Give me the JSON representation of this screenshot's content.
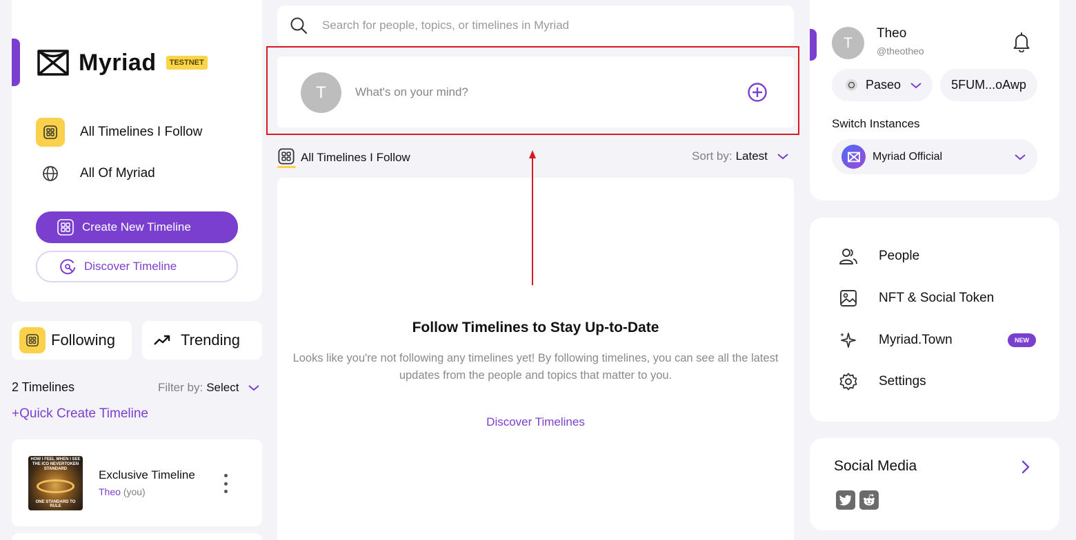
{
  "brand": {
    "name": "Myriad",
    "badge": "TESTNET"
  },
  "left_nav": {
    "items": [
      {
        "label": "All Timelines I Follow",
        "icon": "timeline-folder-icon"
      },
      {
        "label": "All Of Myriad",
        "icon": "globe-icon"
      }
    ],
    "create_button": "Create New Timeline",
    "discover_button": "Discover Timeline"
  },
  "tabs": {
    "following": "Following",
    "trending": "Trending"
  },
  "timelines_panel": {
    "count_label": "2 Timelines",
    "filter_label": "Filter by:",
    "filter_value": "Select",
    "quick_create": "+Quick Create Timeline",
    "items": [
      {
        "title": "Exclusive Timeline",
        "owner": "Theo",
        "owner_suffix": "(you)",
        "thumb_top": "HOW I FEEL WHEN I SEE THE ICO NEVERTOKEN STANDARD",
        "thumb_bottom": "ONE STANDARD TO RULE"
      }
    ]
  },
  "search": {
    "placeholder": "Search for people, topics, or timelines in Myriad"
  },
  "composer": {
    "avatar_initial": "T",
    "placeholder": "What's on your mind?"
  },
  "feed_header": {
    "title": "All Timelines I Follow",
    "sort_label": "Sort by:",
    "sort_value": "Latest"
  },
  "empty_state": {
    "title": "Follow Timelines to Stay Up-to-Date",
    "body": "Looks like you're not following any timelines yet! By following timelines, you can see all the latest updates from the people and topics that matter to you.",
    "link": "Discover Timelines"
  },
  "profile": {
    "initial": "T",
    "name": "Theo",
    "handle": "@theotheo",
    "network": "Paseo",
    "wallet": "5FUM...oAwp",
    "switch_label": "Switch Instances",
    "instance": "Myriad Official"
  },
  "right_nav": {
    "items": [
      {
        "label": "People",
        "icon": "people-icon"
      },
      {
        "label": "NFT & Social Token",
        "icon": "image-icon"
      },
      {
        "label": "Myriad.Town",
        "icon": "sparkles-icon",
        "badge": "NEW"
      },
      {
        "label": "Settings",
        "icon": "gear-icon"
      }
    ]
  },
  "social": {
    "title": "Social Media",
    "icons": [
      "twitter-icon",
      "reddit-icon"
    ]
  },
  "colors": {
    "accent": "#7b3fd0",
    "yellow": "#fbd04b",
    "annotation_red": "#d8191f"
  }
}
